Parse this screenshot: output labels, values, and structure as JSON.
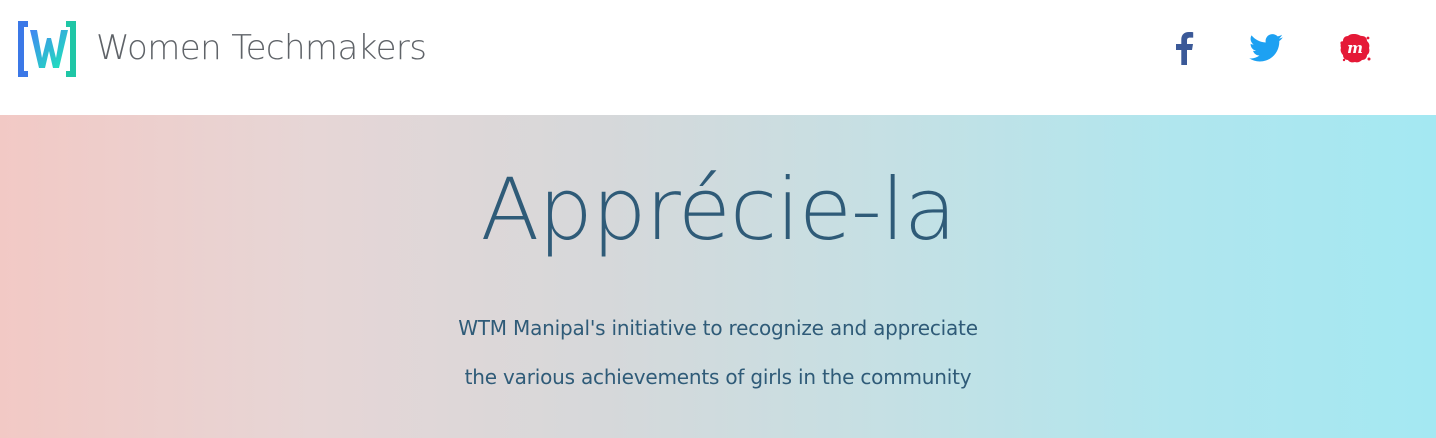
{
  "header": {
    "brand_name": "Women Techmakers",
    "logo_icon": "wtm-logo-icon"
  },
  "social": [
    {
      "name": "facebook-icon",
      "color": "#3b5998"
    },
    {
      "name": "twitter-icon",
      "color": "#1da1f2"
    },
    {
      "name": "meetup-icon",
      "color": "#e51937"
    }
  ],
  "hero": {
    "title": "Apprécie-la",
    "line1": "WTM Manipal's initiative to recognize and appreciate",
    "line2": "the various achievements of girls in the community"
  },
  "colors": {
    "text_primary": "#2f5b78",
    "brand_text": "#5f6368",
    "gradient_left": "#f2c9c5",
    "gradient_right": "#a4e8f2"
  }
}
